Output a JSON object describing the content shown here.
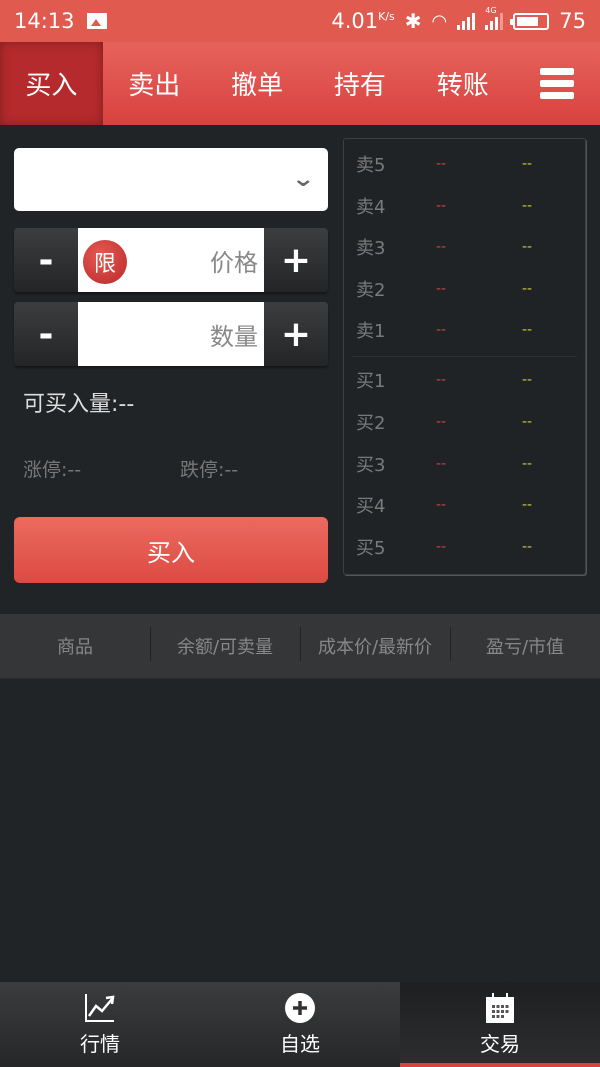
{
  "status_bar": {
    "time": "14:13",
    "network_speed": "4.01",
    "speed_unit": "K/s",
    "network_type": "4G",
    "battery": "75"
  },
  "top_nav": {
    "tabs": [
      {
        "label": "买入",
        "active": true
      },
      {
        "label": "卖出",
        "active": false
      },
      {
        "label": "撤单",
        "active": false
      },
      {
        "label": "持有",
        "active": false
      },
      {
        "label": "转账",
        "active": false
      }
    ]
  },
  "order_form": {
    "stock_select_value": "",
    "price": {
      "minus": "-",
      "plus": "+",
      "badge": "限",
      "placeholder": "价格"
    },
    "quantity": {
      "minus": "-",
      "plus": "+",
      "placeholder": "数量"
    },
    "buyable_qty": "可买入量:--",
    "limit_up": "涨停:--",
    "limit_down": "跌停:--",
    "submit_label": "买入"
  },
  "order_book": {
    "asks": [
      {
        "label": "卖5",
        "price": "--",
        "volume": "--"
      },
      {
        "label": "卖4",
        "price": "--",
        "volume": "--"
      },
      {
        "label": "卖3",
        "price": "--",
        "volume": "--"
      },
      {
        "label": "卖2",
        "price": "--",
        "volume": "--"
      },
      {
        "label": "卖1",
        "price": "--",
        "volume": "--"
      }
    ],
    "bids": [
      {
        "label": "买1",
        "price": "--",
        "volume": "--"
      },
      {
        "label": "买2",
        "price": "--",
        "volume": "--"
      },
      {
        "label": "买3",
        "price": "--",
        "volume": "--"
      },
      {
        "label": "买4",
        "price": "--",
        "volume": "--"
      },
      {
        "label": "买5",
        "price": "--",
        "volume": "--"
      }
    ]
  },
  "holdings_table": {
    "columns": [
      "商品",
      "余额/可卖量",
      "成本价/最新价",
      "盈亏/市值"
    ],
    "rows": []
  },
  "bottom_nav": {
    "items": [
      {
        "label": "行情",
        "icon": "chart-trend-icon",
        "active": false
      },
      {
        "label": "自选",
        "icon": "plus-circle-icon",
        "active": false
      },
      {
        "label": "交易",
        "icon": "calendar-icon",
        "active": true
      }
    ]
  },
  "colors": {
    "brand_red": "#e05a50",
    "ask_price": "#c94646",
    "volume_yellow": "#c9cc3e"
  }
}
